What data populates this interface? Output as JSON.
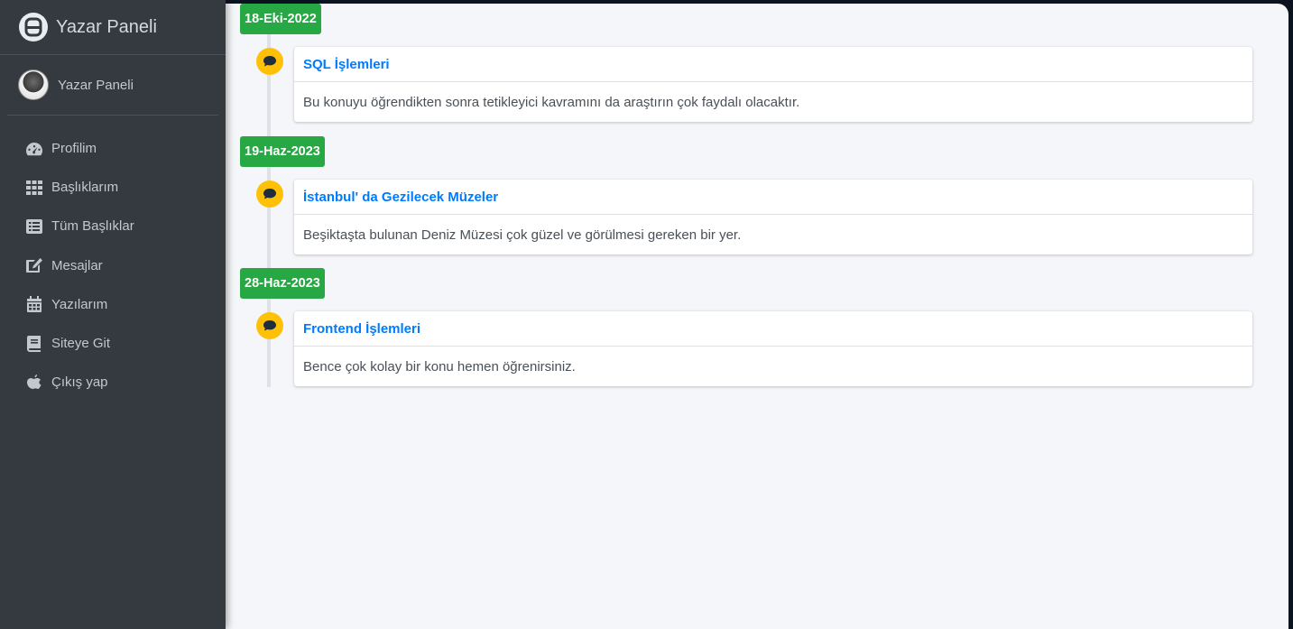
{
  "brand": {
    "title": "Yazar Paneli",
    "icon": "letter-a-logo-icon"
  },
  "user": {
    "name": "Yazar Paneli",
    "avatar": "user-avatar"
  },
  "nav": {
    "items": [
      {
        "label": "Profilim",
        "icon": "tachometer-icon"
      },
      {
        "label": "Başlıklarım",
        "icon": "grid-icon"
      },
      {
        "label": "Tüm Başlıklar",
        "icon": "list-alt-icon"
      },
      {
        "label": "Mesajlar",
        "icon": "edit-icon"
      },
      {
        "label": "Yazılarım",
        "icon": "calendar-icon"
      },
      {
        "label": "Siteye Git",
        "icon": "book-icon"
      },
      {
        "label": "Çıkış yap",
        "icon": "apple-icon"
      }
    ]
  },
  "timeline": [
    {
      "date": "18-Eki-2022",
      "title": "SQL İşlemleri",
      "body": "Bu konuyu öğrendikten sonra tetikleyici kavramını da araştırın çok faydalı olacaktır.",
      "icon": "comment-icon"
    },
    {
      "date": "19-Haz-2023",
      "title": "İstanbul' da Gezilecek Müzeler",
      "body": "Beşiktaşta bulunan Deniz Müzesi çok güzel ve görülmesi gereken bir yer.",
      "icon": "comment-icon"
    },
    {
      "date": "28-Haz-2023",
      "title": "Frontend İşlemleri",
      "body": "Bence çok kolay bir konu hemen öğrenirsiniz.",
      "icon": "comment-icon"
    }
  ],
  "colors": {
    "sidebar_bg": "#343a40",
    "date_badge": "#28a745",
    "timeline_icon": "#ffc107",
    "link": "#007bff",
    "content_bg": "#f4f6f9"
  }
}
